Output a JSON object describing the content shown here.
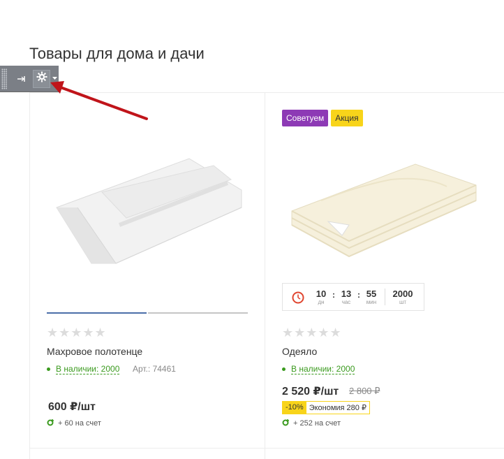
{
  "page": {
    "title": "Товары для дома и дачи"
  },
  "toolbar": {
    "icons": [
      "grip-icon",
      "pin-icon",
      "gear-icon",
      "caret-down-icon"
    ]
  },
  "products": [
    {
      "name": "Махровое полотенце",
      "rating_stars": "★★★★★",
      "stock": "В наличии: 2000",
      "article": "Арт.: 74461",
      "price": "600 ₽/шт",
      "bonus": "+ 60 на счет",
      "image": "towel-image"
    },
    {
      "name": "Одеяло",
      "badges": [
        "Советуем",
        "Акция"
      ],
      "timer": {
        "days": "10",
        "days_label": "дн",
        "hours": "13",
        "hours_label": "час",
        "minutes": "55",
        "minutes_label": "мин",
        "qty": "2000",
        "qty_label": "шт"
      },
      "rating_stars": "★★★★★",
      "stock": "В наличии: 2000",
      "price": "2 520 ₽/шт",
      "old_price": "2 800 ₽",
      "discount": "-10%",
      "economy": "Экономия 280 ₽",
      "bonus": "+ 252 на счет",
      "image": "blanket-image"
    }
  ],
  "colors": {
    "badge_recommend": "#8d3ab5",
    "badge_sale": "#f8d41a",
    "stock_green": "#3a9a1e",
    "toolbar_bg": "#7b7f86",
    "arrow_red": "#c0141a"
  }
}
